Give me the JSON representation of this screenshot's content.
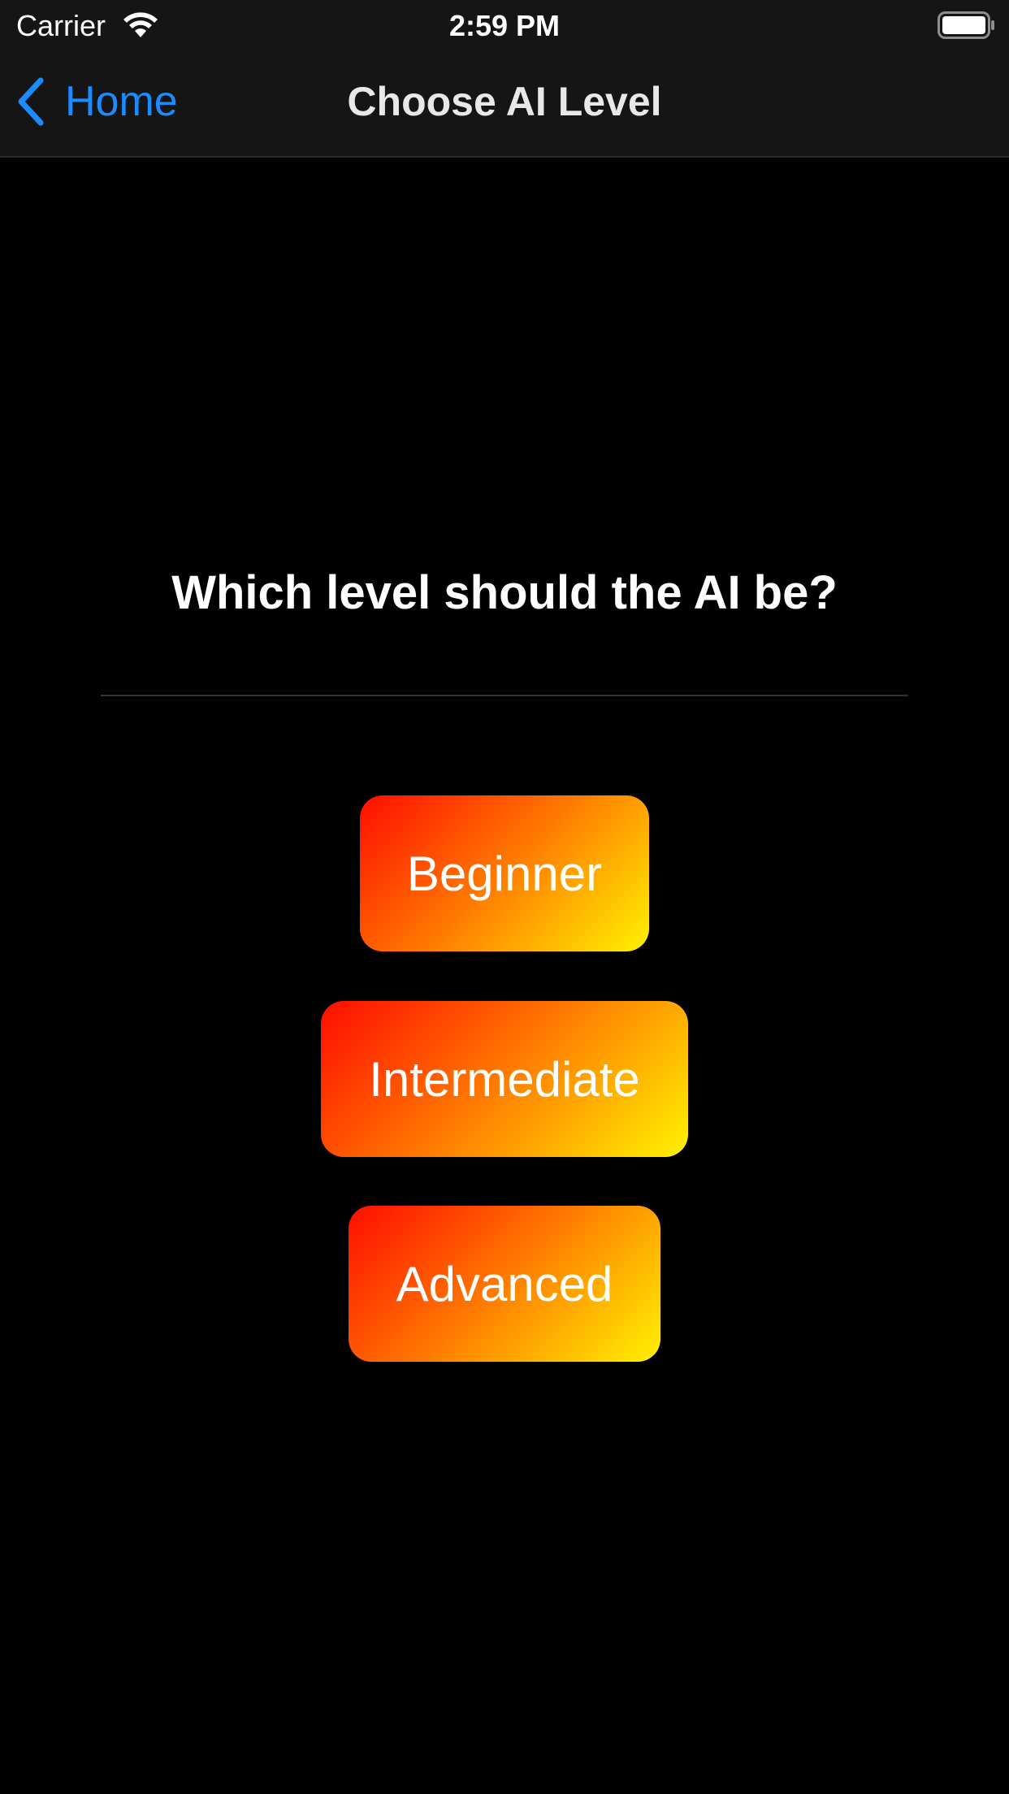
{
  "status_bar": {
    "carrier": "Carrier",
    "time": "2:59 PM",
    "wifi_icon": "wifi-icon",
    "battery_icon": "battery-full-icon"
  },
  "nav_bar": {
    "back_label": "Home",
    "back_icon": "chevron-left-icon",
    "title": "Choose AI Level"
  },
  "content": {
    "question": "Which level should the AI be?",
    "levels": [
      {
        "label": "Beginner"
      },
      {
        "label": "Intermediate"
      },
      {
        "label": "Advanced"
      }
    ]
  },
  "colors": {
    "background": "#000000",
    "bar_background": "#151515",
    "accent_blue": "#1a8cff",
    "gradient_start": "#ff0d00",
    "gradient_end": "#fff200"
  }
}
